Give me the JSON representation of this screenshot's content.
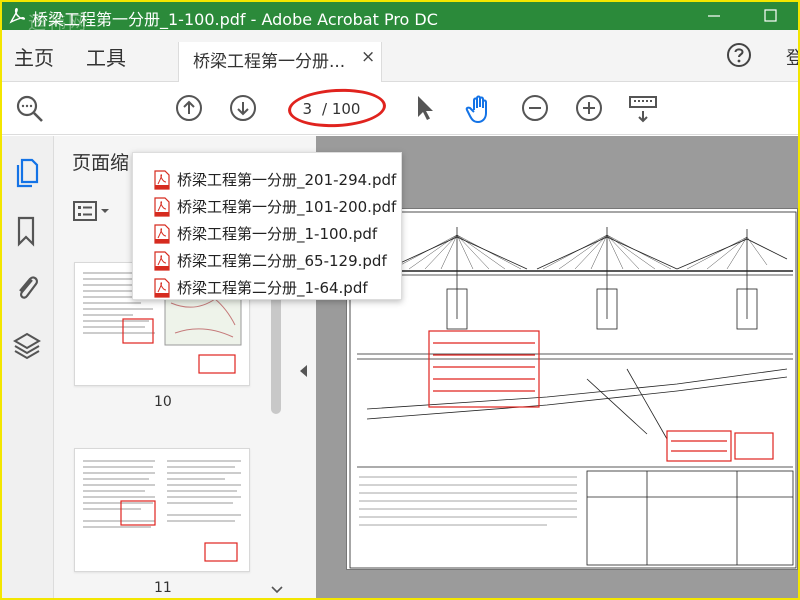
{
  "window": {
    "title": "桥梁工程第一分册_1-100.pdf - Adobe Acrobat Pro DC",
    "watermark": "迪祎网"
  },
  "menu": {
    "home": "主页",
    "tools": "工具",
    "login": "登"
  },
  "tab": {
    "label": "桥梁工程第一分册...",
    "close": "×"
  },
  "toolbar": {
    "current_page": "3",
    "page_total": "/ 100"
  },
  "panel": {
    "title": "页面缩"
  },
  "thumbnails": [
    {
      "num": "10"
    },
    {
      "num": "11"
    }
  ],
  "recent_files": [
    "桥梁工程第一分册_201-294.pdf",
    "桥梁工程第一分册_101-200.pdf",
    "桥梁工程第一分册_1-100.pdf",
    "桥梁工程第二分册_65-129.pdf",
    "桥梁工程第二分册_1-64.pdf"
  ],
  "icons": {
    "app": "acrobat-icon",
    "zoom": "magnifier-icon",
    "up": "arrow-up-icon",
    "down": "arrow-down-icon",
    "select": "cursor-icon",
    "hand": "hand-icon",
    "zoom_out": "zoom-out-icon",
    "zoom_in": "zoom-in-icon",
    "keyboard": "keyboard-icon",
    "pages": "pages-icon",
    "bookmark": "bookmark-icon",
    "attach": "paperclip-icon",
    "layers": "layers-icon"
  },
  "colors": {
    "titlebar": "#2b8a3a",
    "accent": "#1473e6",
    "annotation": "#e0231e",
    "pdf_red": "#d62b1f"
  }
}
